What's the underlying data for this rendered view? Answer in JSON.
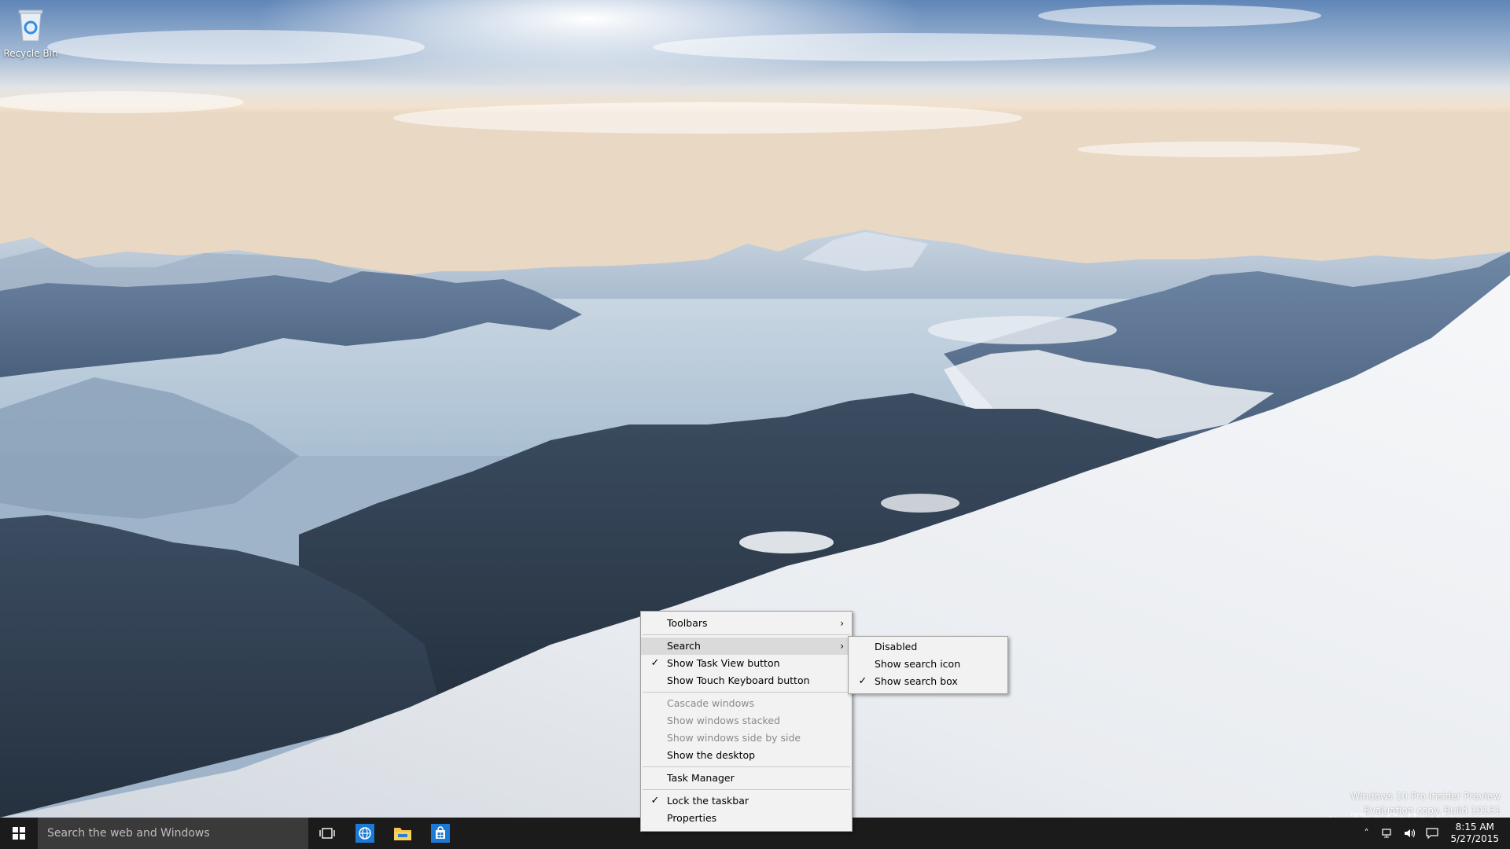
{
  "desktop": {
    "recycle_bin_label": "Recycle Bin"
  },
  "taskbar": {
    "search_placeholder": "Search the web and Windows",
    "pinned": [
      {
        "name": "task-view",
        "icon": "task-view-icon"
      },
      {
        "name": "edge",
        "icon": "globe-icon"
      },
      {
        "name": "file-explorer",
        "icon": "folder-icon"
      },
      {
        "name": "store",
        "icon": "store-icon"
      }
    ],
    "clock_time": "8:15 AM",
    "clock_date": "5/27/2015"
  },
  "watermark": {
    "line1": "Windows 10 Pro Insider Preview",
    "line2": "Evaluation copy. Build 10131",
    "brand": "The Collection Book"
  },
  "context_menu": {
    "items": {
      "toolbars": {
        "label": "Toolbars",
        "checked": false,
        "submenu": true
      },
      "search": {
        "label": "Search",
        "checked": false,
        "submenu": true
      },
      "task_view": {
        "label": "Show Task View button",
        "checked": true
      },
      "touch_keyboard": {
        "label": "Show Touch Keyboard button",
        "checked": false
      },
      "cascade": {
        "label": "Cascade windows",
        "disabled": true
      },
      "stacked": {
        "label": "Show windows stacked",
        "disabled": true
      },
      "side_by_side": {
        "label": "Show windows side by side",
        "disabled": true
      },
      "desktop": {
        "label": "Show the desktop"
      },
      "task_manager": {
        "label": "Task Manager"
      },
      "lock": {
        "label": "Lock the taskbar",
        "checked": true
      },
      "properties": {
        "label": "Properties"
      }
    },
    "check_glyph": "✓",
    "arrow_glyph": "›"
  },
  "search_submenu": {
    "disabled": {
      "label": "Disabled",
      "checked": false
    },
    "icon": {
      "label": "Show search icon",
      "checked": false
    },
    "box": {
      "label": "Show search box",
      "checked": true
    }
  },
  "colors": {
    "taskbar": "#1b1b1b",
    "search_box": "#3a3a3a",
    "menu_bg": "#f2f2f2",
    "menu_hover": "#dadada",
    "accent": "#0a73c9"
  }
}
